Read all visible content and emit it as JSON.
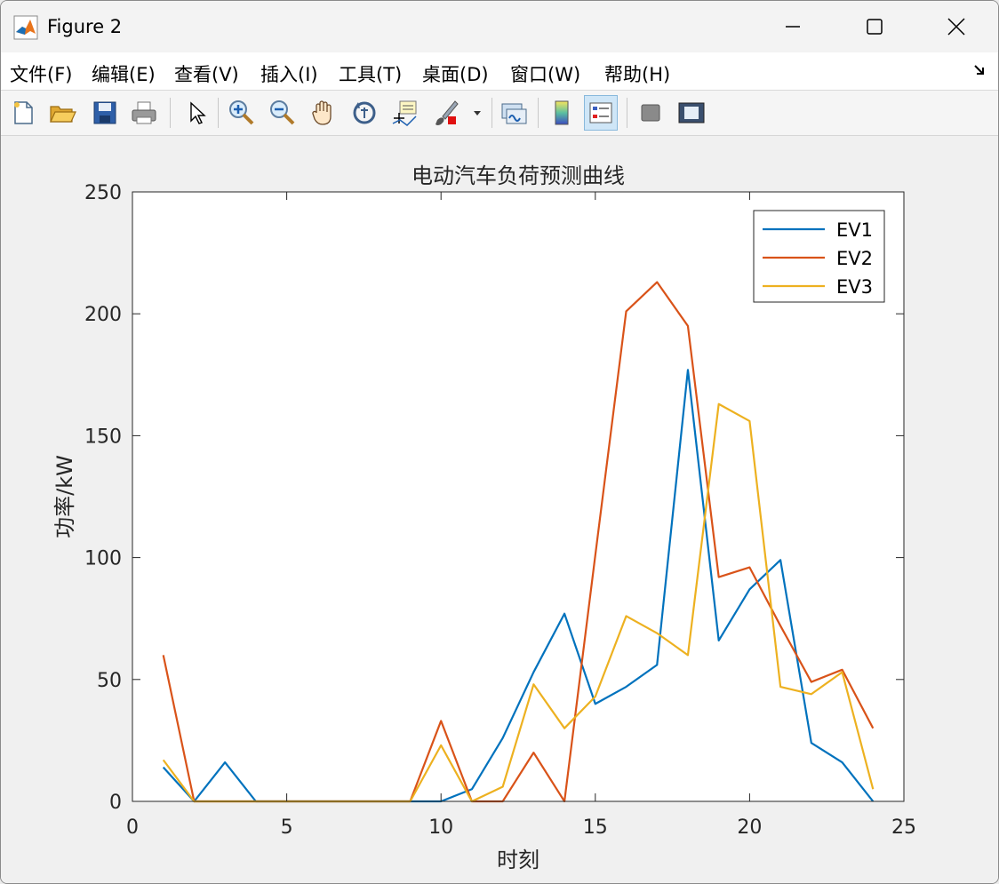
{
  "window": {
    "title": "Figure 2"
  },
  "menu": {
    "items": [
      "文件(F)",
      "编辑(E)",
      "查看(V)",
      "插入(I)",
      "工具(T)",
      "桌面(D)",
      "窗口(W)",
      "帮助(H)"
    ]
  },
  "toolbar": {
    "icons": [
      "new-figure-icon",
      "open-file-icon",
      "save-icon",
      "print-icon",
      "pointer-icon",
      "zoom-in-icon",
      "zoom-out-icon",
      "pan-hand-icon",
      "rotate-3d-icon",
      "data-cursor-icon",
      "brush-icon",
      "link-plot-icon",
      "colorbar-icon",
      "legend-icon",
      "hide-plot-tools-icon",
      "show-plot-tools-icon"
    ],
    "active": "legend-icon"
  },
  "chart_data": {
    "type": "line",
    "title": "电动汽车负荷预测曲线",
    "xlabel": "时刻",
    "ylabel": "功率/kW",
    "xlim": [
      0,
      25
    ],
    "ylim": [
      0,
      250
    ],
    "xticks": [
      0,
      5,
      10,
      15,
      20,
      25
    ],
    "yticks": [
      0,
      50,
      100,
      150,
      200,
      250
    ],
    "grid": false,
    "legend_position": "top-right",
    "x": [
      1,
      2,
      3,
      4,
      5,
      6,
      7,
      8,
      9,
      10,
      11,
      12,
      13,
      14,
      15,
      16,
      17,
      18,
      19,
      20,
      21,
      22,
      23,
      24
    ],
    "series": [
      {
        "name": "EV1",
        "color": "#0072BD",
        "values": [
          14,
          0,
          16,
          0,
          0,
          0,
          0,
          0,
          0,
          0,
          5,
          26,
          53,
          77,
          40,
          47,
          56,
          177,
          66,
          87,
          99,
          24,
          16,
          0
        ]
      },
      {
        "name": "EV2",
        "color": "#D95319",
        "values": [
          60,
          0,
          0,
          0,
          0,
          0,
          0,
          0,
          0,
          33,
          0,
          0,
          20,
          0,
          101,
          201,
          213,
          195,
          92,
          96,
          72,
          49,
          54,
          30
        ]
      },
      {
        "name": "EV3",
        "color": "#EDB120",
        "values": [
          17,
          0,
          0,
          0,
          0,
          0,
          0,
          0,
          0,
          23,
          0,
          6,
          48,
          30,
          43,
          76,
          69,
          60,
          163,
          156,
          47,
          44,
          53,
          5
        ]
      }
    ]
  }
}
